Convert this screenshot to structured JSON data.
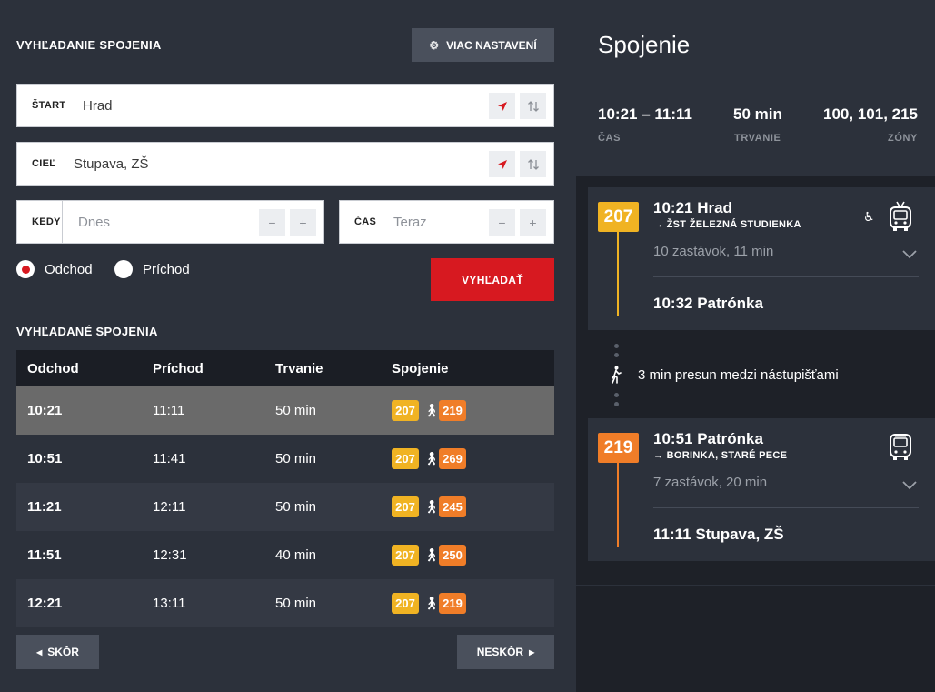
{
  "search": {
    "title": "VYHĽADANIE SPOJENIA",
    "more_settings": "VIAC NASTAVENÍ",
    "start": {
      "label": "ŠTART",
      "value": "Hrad"
    },
    "dest": {
      "label": "CIEĽ",
      "value": "Stupava, ZŠ"
    },
    "when": {
      "label": "KEDY",
      "placeholder": "Dnes"
    },
    "time": {
      "label": "ČAS",
      "placeholder": "Teraz"
    },
    "minus": "−",
    "plus": "+",
    "radio_departure": "Odchod",
    "radio_arrival": "Príchod",
    "selected_radio": "Odchod",
    "submit": "VYHĽADAŤ"
  },
  "results": {
    "title": "VYHĽADANÉ SPOJENIA",
    "columns": [
      "Odchod",
      "Príchod",
      "Trvanie",
      "Spojenie"
    ],
    "rows": [
      {
        "dep": "10:21",
        "arr": "11:11",
        "dur": "50 min",
        "l1": "207",
        "l2": "219"
      },
      {
        "dep": "10:51",
        "arr": "11:41",
        "dur": "50 min",
        "l1": "207",
        "l2": "269"
      },
      {
        "dep": "11:21",
        "arr": "12:11",
        "dur": "50 min",
        "l1": "207",
        "l2": "245"
      },
      {
        "dep": "11:51",
        "arr": "12:31",
        "dur": "40 min",
        "l1": "207",
        "l2": "250"
      },
      {
        "dep": "12:21",
        "arr": "13:11",
        "dur": "50 min",
        "l1": "207",
        "l2": "219"
      }
    ],
    "selected_index": 0,
    "earlier": "SKÔR",
    "later": "NESKÔR"
  },
  "detail": {
    "title": "Spojenie",
    "summary": {
      "time": "10:21 – 11:11",
      "time_label": "ČAS",
      "duration": "50 min",
      "duration_label": "TRVANIE",
      "zones": "100, 101, 215",
      "zones_label": "ZÓNY"
    },
    "legs": [
      {
        "line": "207",
        "departure": "10:21 Hrad",
        "direction": "→ ŽST ŽELEZNÁ STUDIENKA",
        "stops": "10 zastávok, 11 min",
        "arrival": "10:32 Patrónka",
        "wheelchair": "♿",
        "vehicle_icon": "trolleybus-icon"
      },
      {
        "line": "219",
        "departure": "10:51 Patrónka",
        "direction": "→ BORINKA, STARÉ PECE",
        "stops": "7 zastávok, 20 min",
        "arrival": "11:11 Stupava, ZŠ",
        "vehicle_icon": "bus-icon"
      }
    ],
    "transfer": "3 min presun medzi nástupišťami"
  },
  "colors": {
    "accent_red": "#d71920",
    "line_yellow": "#f0b323",
    "line_orange": "#f07d28",
    "panel_dark": "#2c313b"
  }
}
